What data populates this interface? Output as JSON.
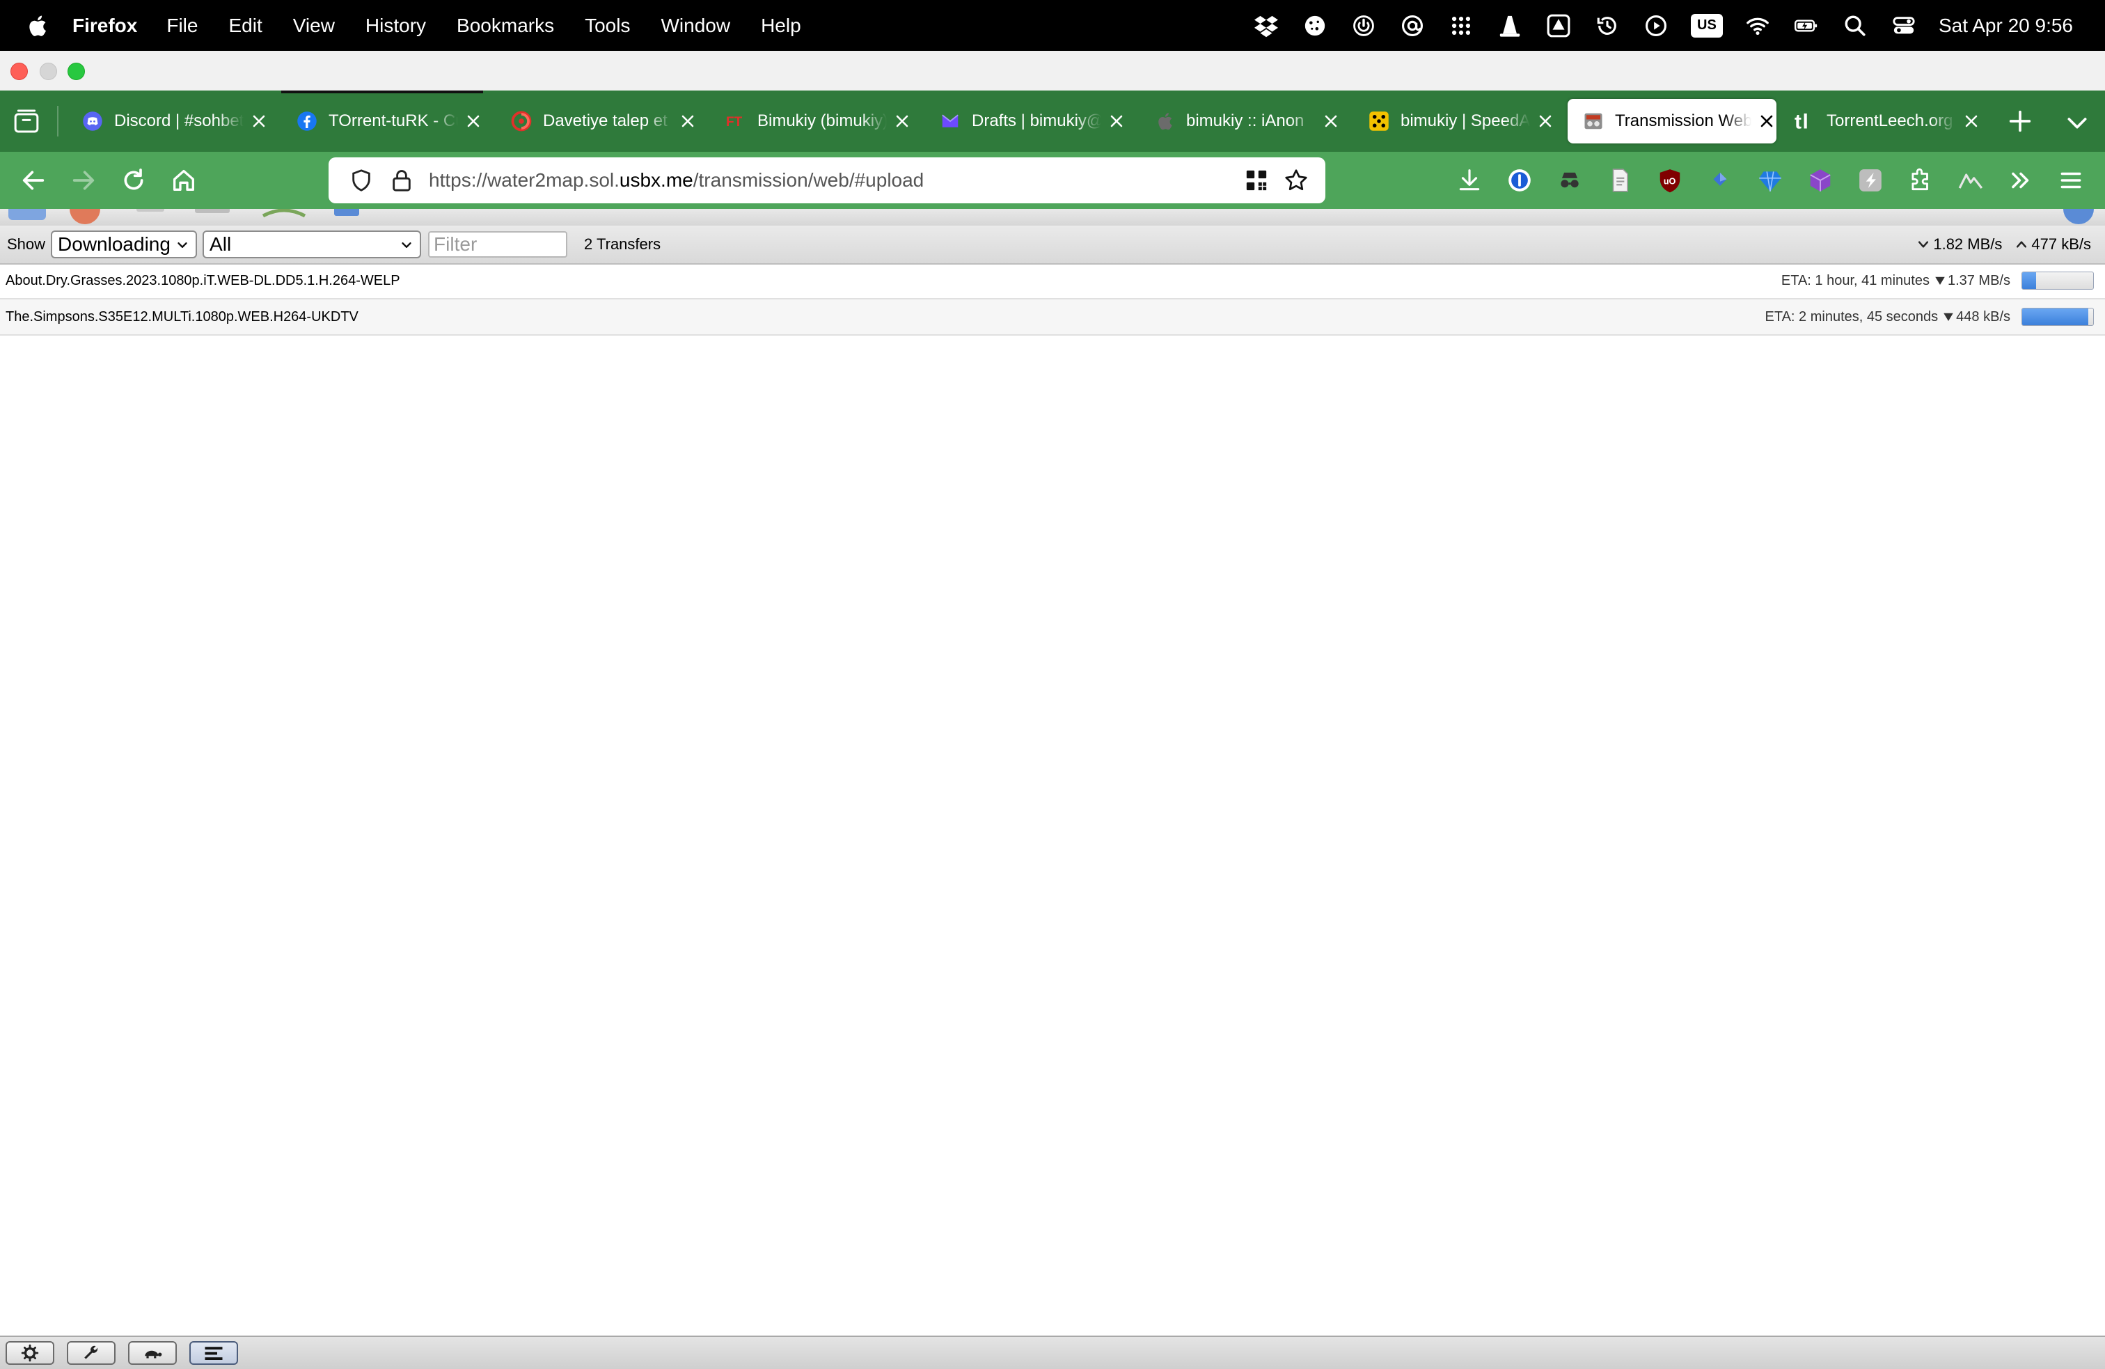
{
  "menubar": {
    "app_name": "Firefox",
    "items": [
      "File",
      "Edit",
      "View",
      "History",
      "Bookmarks",
      "Tools",
      "Window",
      "Help"
    ],
    "keyboard_layout": "US",
    "clock": "Sat Apr 20  9:56"
  },
  "tabs": [
    {
      "label": "Discord | #sohbet",
      "favicon": "discord-icon",
      "color": "#5865f2"
    },
    {
      "label": "TOrrent-tuRK - Cu",
      "favicon": "facebook-icon",
      "color": "#1877f2"
    },
    {
      "label": "Davetiye talep et |",
      "favicon": "swirl-icon",
      "color": "#e0302a"
    },
    {
      "label": "Bimukiy (bimukiy)",
      "favicon": "ft-icon",
      "color": "#e0302a"
    },
    {
      "label": "Drafts | bimukiy@",
      "favicon": "proton-mail-icon",
      "color": "#6d4aff"
    },
    {
      "label": "bimukiy :: iAnon",
      "favicon": "apple-icon",
      "color": "#555555"
    },
    {
      "label": "bimukiy | SpeedAp",
      "favicon": "dice-icon",
      "color": "#f2c200"
    },
    {
      "label": "Transmission Web",
      "favicon": "transmission-icon",
      "color": "#c23b22",
      "active": true
    },
    {
      "label": "TorrentLeech.org",
      "favicon": "tl-icon",
      "color": "#2b9a2b"
    }
  ],
  "urlbar": {
    "prefix": "https://water2map.sol.",
    "host": "usbx.me",
    "path": "/transmission/web/#upload"
  },
  "filterbar": {
    "show_label": "Show",
    "status_filter": "Downloading",
    "tracker_filter": "All",
    "filter_placeholder": "Filter",
    "transfer_count": "2 Transfers",
    "download_speed": "1.82 MB/s",
    "upload_speed": "477 kB/s"
  },
  "torrents": [
    {
      "name": "About.Dry.Grasses.2023.1080p.iT.WEB-DL.DD5.1.H.264-WELP",
      "eta": "ETA: 1 hour, 41 minutes",
      "rate": "1.37 MB/s",
      "progress": 0.2
    },
    {
      "name": "The.Simpsons.S35E12.MULTi.1080p.WEB.H264-UKDTV",
      "eta": "ETA: 2 minutes, 45 seconds",
      "rate": "448 kB/s",
      "progress": 0.93
    }
  ],
  "colors": {
    "tab_strip": "#2f7a3b",
    "nav_toolbar": "#4ea55a",
    "progress_fill": "#3c80db"
  }
}
